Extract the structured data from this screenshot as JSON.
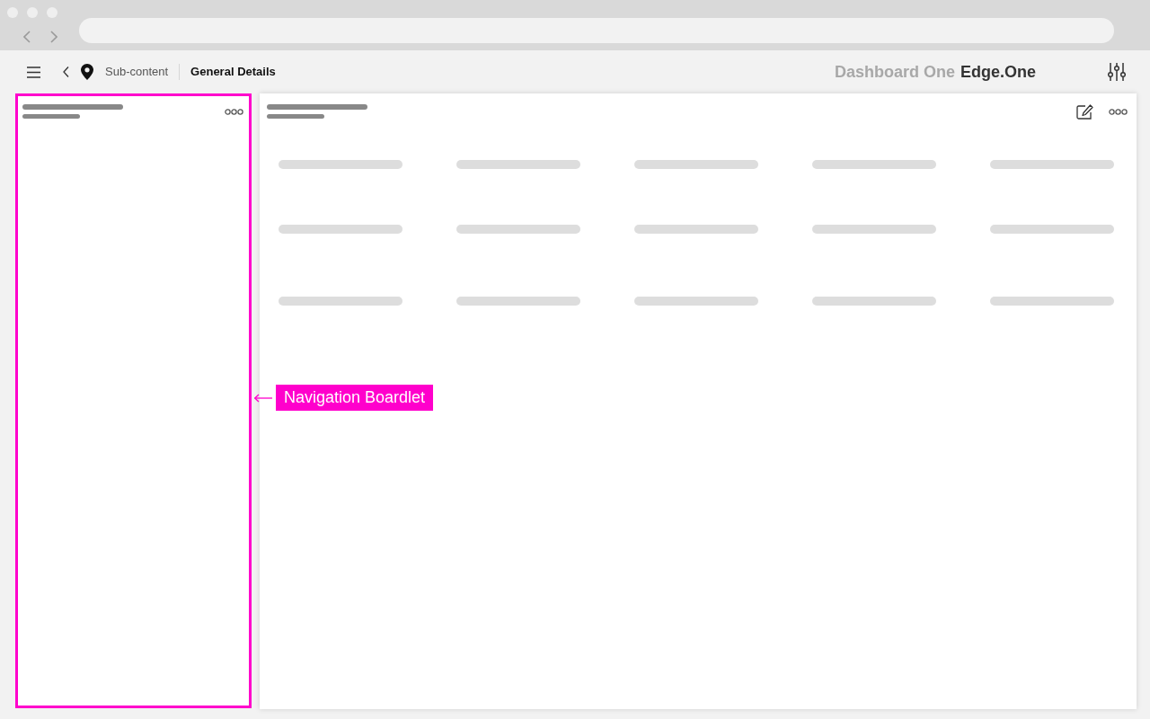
{
  "top_bar": {
    "breadcrumb": [
      {
        "label": "Sub-content",
        "selected": false
      },
      {
        "label": "General Details",
        "selected": true
      }
    ],
    "app_name": "Dashboard One",
    "brand": "Edge.One"
  },
  "navigation_panel": {
    "highlighted": true,
    "header_lines": [
      {
        "kind": "placeholder"
      },
      {
        "kind": "placeholder"
      }
    ]
  },
  "content_panel": {
    "header_lines": [
      {
        "kind": "placeholder"
      },
      {
        "kind": "placeholder"
      }
    ],
    "rows": [
      {
        "cells": [
          {
            "kind": "placeholder"
          },
          {
            "kind": "placeholder"
          },
          {
            "kind": "placeholder"
          },
          {
            "kind": "placeholder"
          },
          {
            "kind": "placeholder"
          }
        ]
      },
      {
        "cells": [
          {
            "kind": "placeholder"
          },
          {
            "kind": "placeholder"
          },
          {
            "kind": "placeholder"
          },
          {
            "kind": "placeholder"
          },
          {
            "kind": "placeholder"
          }
        ]
      },
      {
        "cells": [
          {
            "kind": "placeholder"
          },
          {
            "kind": "placeholder"
          },
          {
            "kind": "placeholder"
          },
          {
            "kind": "placeholder"
          },
          {
            "kind": "placeholder"
          }
        ]
      }
    ]
  },
  "annotation": {
    "label": "Navigation Boardlet"
  }
}
